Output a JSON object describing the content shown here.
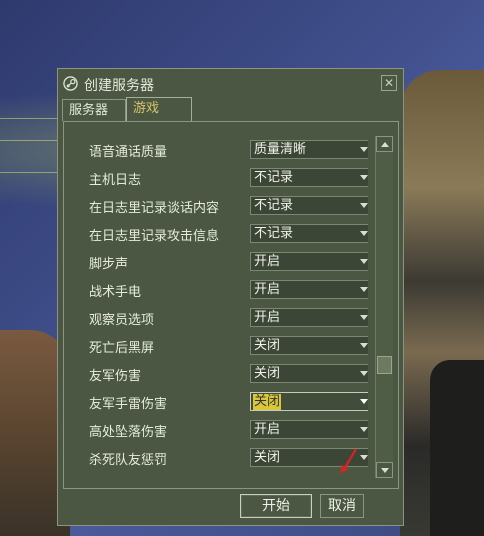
{
  "window": {
    "title": "创建服务器",
    "close_glyph": "✕"
  },
  "tabs": [
    {
      "label": "服务器",
      "active": false
    },
    {
      "label": "游戏",
      "active": true
    }
  ],
  "settings": [
    {
      "label": "语音通话质量",
      "value": "质量清晰"
    },
    {
      "label": "主机日志",
      "value": "不记录"
    },
    {
      "label": "在日志里记录谈话内容",
      "value": "不记录"
    },
    {
      "label": "在日志里记录攻击信息",
      "value": "不记录"
    },
    {
      "label": "脚步声",
      "value": "开启"
    },
    {
      "label": "战术手电",
      "value": "开启"
    },
    {
      "label": "观察员选项",
      "value": "开启"
    },
    {
      "label": "死亡后黑屏",
      "value": "关闭"
    },
    {
      "label": "友军伤害",
      "value": "关闭"
    },
    {
      "label": "友军手雷伤害",
      "value": "关闭",
      "highlighted": true
    },
    {
      "label": "高处坠落伤害",
      "value": "开启"
    },
    {
      "label": "杀死队友惩罚",
      "value": "关闭"
    }
  ],
  "scrollbar": {
    "position_fraction": 0.7
  },
  "buttons": {
    "start_label": "开始",
    "cancel_label": "取消"
  },
  "colors": {
    "dialog_bg": "#4b5742",
    "active_tab_text": "#d7c56b",
    "highlight": "#d8c73a",
    "pointer": "#e02020"
  }
}
